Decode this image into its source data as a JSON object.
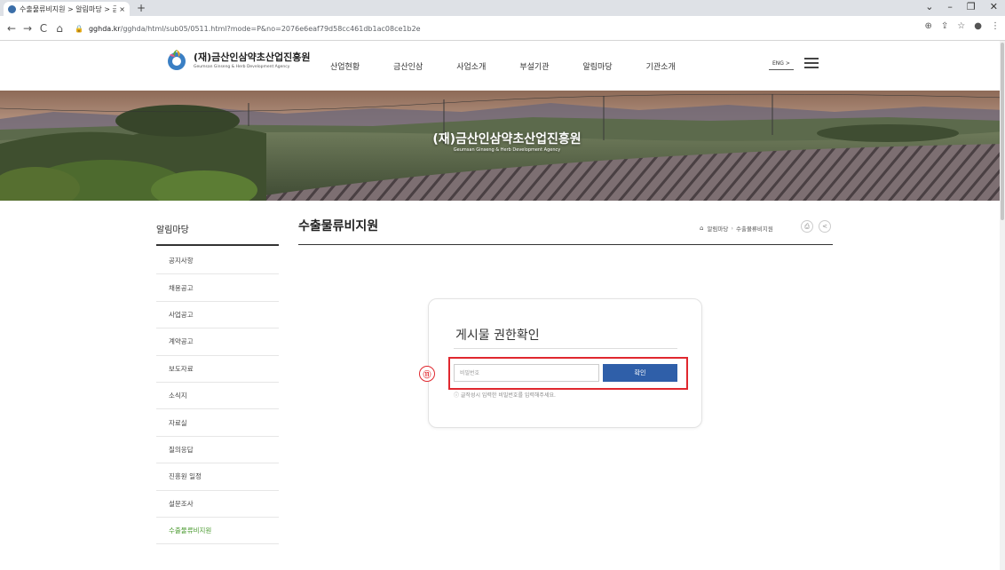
{
  "browser": {
    "tab_title": "수출물류비지원 > 알림마당 > 금",
    "tab_close": "×",
    "new_tab": "+",
    "url_host": "gghda.kr",
    "url_path": "/gghda/html/sub05/0511.html?mode=P&no=2076e6eaf79d58cc461db1ac08ce1b2e",
    "window_controls": [
      "⌄",
      "–",
      "❐",
      "✕"
    ],
    "nav": {
      "back": "←",
      "forward": "→",
      "reload": "C",
      "home": "⌂"
    }
  },
  "header": {
    "logo_title": "(재)금산인삼약초산업진흥원",
    "logo_subtitle": "Geumsan Ginseng & Herb Development Agency",
    "nav": [
      "산업현황",
      "금산인삼",
      "사업소개",
      "부설기관",
      "알림마당",
      "기관소개"
    ],
    "lang": "ENG >"
  },
  "banner": {
    "title": "(재)금산인삼약초산업진흥원",
    "subtitle": "Geumsan Ginseng & Herb Development Agency"
  },
  "sidebar": {
    "title": "알림마당",
    "items": [
      {
        "label": "공지사항"
      },
      {
        "label": "채용공고"
      },
      {
        "label": "사업공고"
      },
      {
        "label": "계약공고"
      },
      {
        "label": "보도자료"
      },
      {
        "label": "소식지"
      },
      {
        "label": "자료실"
      },
      {
        "label": "질의응답"
      },
      {
        "label": "진흥원 일정"
      },
      {
        "label": "설문조사"
      },
      {
        "label": "수출물류비지원"
      }
    ],
    "active_index": 10
  },
  "content": {
    "page_title": "수출물류비지원",
    "breadcrumb": [
      "알림마당",
      "수출물류비지원"
    ]
  },
  "auth": {
    "title": "게시물 권한확인",
    "password_placeholder": "비밀번호",
    "confirm_label": "확인",
    "note": "ⓘ 글작성시 입력한 비밀번호를 입력해주세요.",
    "marker": "⑪"
  },
  "colors": {
    "accent_green": "#4a9a2f",
    "button_blue": "#2f5fa9",
    "highlight_red": "#e0282f"
  }
}
